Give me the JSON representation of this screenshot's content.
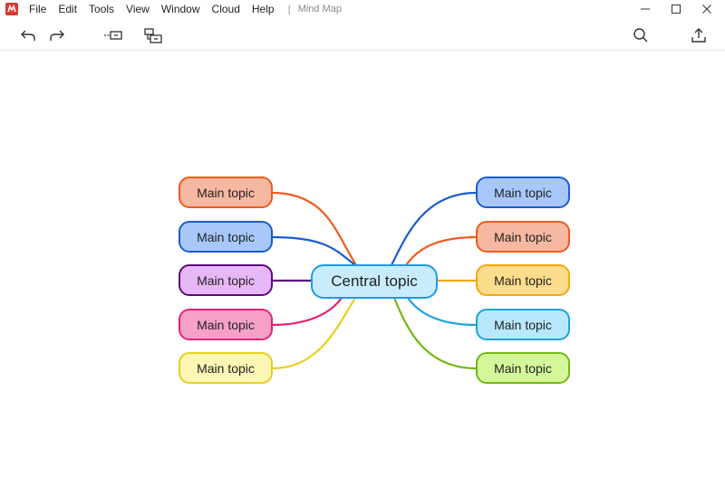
{
  "menubar": {
    "items": [
      "File",
      "Edit",
      "Tools",
      "View",
      "Window",
      "Cloud",
      "Help"
    ],
    "separator": "|",
    "document_title": "Mind Map"
  },
  "window_controls": [
    "minimize-icon",
    "maximize-icon",
    "close-icon"
  ],
  "toolbar": {
    "left": [
      "undo-icon",
      "redo-icon",
      "insert-topic-icon",
      "insert-subtopic-icon"
    ],
    "right": [
      "search-icon",
      "share-export-icon"
    ]
  },
  "colors": {
    "accent": "#d83b2f",
    "central_fill": "#c9ecfd",
    "central_border": "#1f9be0"
  },
  "mindmap": {
    "central": {
      "label": "Central topic"
    },
    "left_topics": [
      {
        "label": "Main topic",
        "fill": "#f7b8a1",
        "border": "#f05a1e"
      },
      {
        "label": "Main topic",
        "fill": "#a8c8fb",
        "border": "#1b5bd0"
      },
      {
        "label": "Main topic",
        "fill": "#e8b7f7",
        "border": "#5b0a7d"
      },
      {
        "label": "Main topic",
        "fill": "#f7a0c7",
        "border": "#e8207a"
      },
      {
        "label": "Main topic",
        "fill": "#fdf6b5",
        "border": "#e8cf1a"
      }
    ],
    "right_topics": [
      {
        "label": "Main topic",
        "fill": "#a8c8fb",
        "border": "#1b5bd0"
      },
      {
        "label": "Main topic",
        "fill": "#f7b8a1",
        "border": "#f05a1e"
      },
      {
        "label": "Main topic",
        "fill": "#fddc8c",
        "border": "#f5a70e"
      },
      {
        "label": "Main topic",
        "fill": "#b8e8fb",
        "border": "#1ba3e0"
      },
      {
        "label": "Main topic",
        "fill": "#d4f79a",
        "border": "#74b814"
      }
    ]
  }
}
